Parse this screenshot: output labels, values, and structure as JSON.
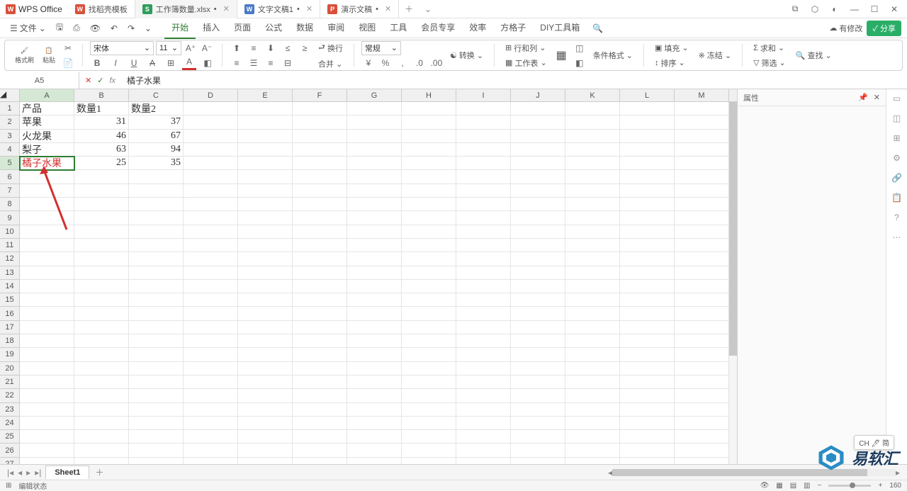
{
  "app": {
    "name": "WPS Office"
  },
  "tabs": [
    {
      "icon_bg": "#d94f3a",
      "icon_text": "W",
      "label": "找稻壳模板",
      "active": false
    },
    {
      "icon_bg": "#2e9e5b",
      "icon_text": "S",
      "label": "工作簿数量.xlsx",
      "active": true,
      "dirty": "•"
    },
    {
      "icon_bg": "#4a7ac7",
      "icon_text": "W",
      "label": "文字文稿1",
      "active": false,
      "dirty": "•"
    },
    {
      "icon_bg": "#d94f3a",
      "icon_text": "P",
      "label": "演示文稿",
      "active": false,
      "dirty": "•"
    }
  ],
  "menu": {
    "file": "文件",
    "tabs": [
      "开始",
      "插入",
      "页面",
      "公式",
      "数据",
      "审阅",
      "视图",
      "工具",
      "会员专享",
      "效率",
      "方格子",
      "DIY工具箱"
    ],
    "active": "开始",
    "changes": "有修改",
    "share": "分享"
  },
  "ribbon": {
    "format_brush": "格式刷",
    "paste": "粘贴",
    "font_name": "宋体",
    "font_size": "11",
    "wrap": "换行",
    "general": "常规",
    "convert": "转换",
    "rows_cols": "行和列",
    "worksheet": "工作表",
    "conditional": "条件格式",
    "fill": "填充",
    "sort": "排序",
    "freeze": "冻结",
    "sum": "求和",
    "filter": "筛选",
    "find": "查找"
  },
  "formula_bar": {
    "cell_ref": "A5",
    "value": "橘子水果"
  },
  "columns": [
    "A",
    "B",
    "C",
    "D",
    "E",
    "F",
    "G",
    "H",
    "I",
    "J",
    "K",
    "L",
    "M"
  ],
  "rows": [
    {
      "n": "1",
      "cells": [
        "产品",
        "数量1",
        "数量2"
      ]
    },
    {
      "n": "2",
      "cells": [
        "苹果",
        "31",
        "37"
      ]
    },
    {
      "n": "3",
      "cells": [
        "火龙果",
        "46",
        "67"
      ]
    },
    {
      "n": "4",
      "cells": [
        "梨子",
        "63",
        "94"
      ]
    },
    {
      "n": "5",
      "cells": [
        "橘子水果",
        "25",
        "35"
      ]
    }
  ],
  "empty_rows": [
    "6",
    "7",
    "8",
    "9",
    "10",
    "11",
    "12",
    "13",
    "14",
    "15",
    "16",
    "17",
    "18",
    "19",
    "20",
    "21",
    "22",
    "23",
    "24",
    "25",
    "26",
    "27"
  ],
  "right_panel": {
    "title": "属性"
  },
  "sheet_tabs": {
    "active": "Sheet1"
  },
  "status": {
    "mode": "编辑状态",
    "zoom": "160"
  },
  "ime": "CH 🖊 简",
  "watermark": "易软汇"
}
